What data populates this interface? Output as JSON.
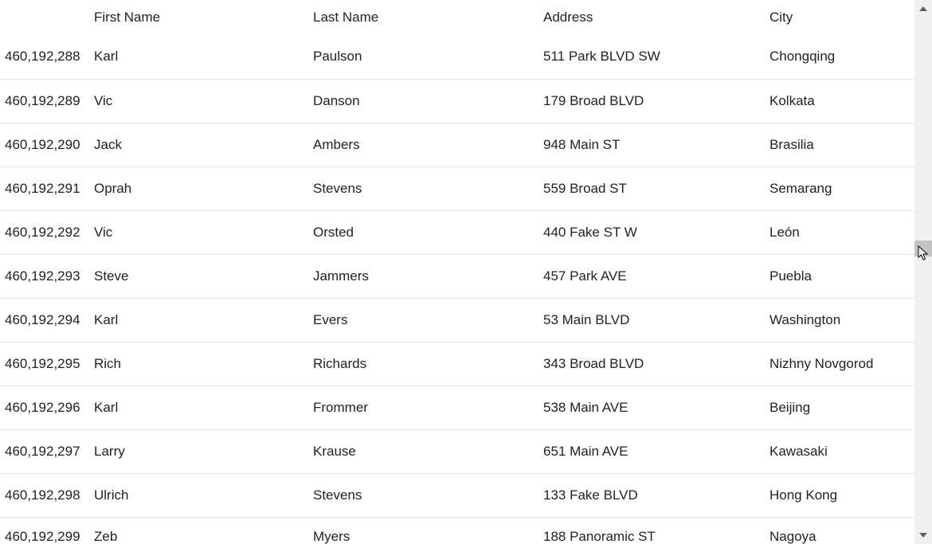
{
  "table": {
    "headers": {
      "id": "",
      "firstName": "First Name",
      "lastName": "Last Name",
      "address": "Address",
      "city": "City"
    },
    "rows": [
      {
        "id": "460,192,288",
        "firstName": "Karl",
        "lastName": "Paulson",
        "address": "511 Park BLVD SW",
        "city": "Chongqing"
      },
      {
        "id": "460,192,289",
        "firstName": "Vic",
        "lastName": "Danson",
        "address": "179 Broad BLVD",
        "city": "Kolkata"
      },
      {
        "id": "460,192,290",
        "firstName": "Jack",
        "lastName": "Ambers",
        "address": "948 Main ST",
        "city": "Brasilia"
      },
      {
        "id": "460,192,291",
        "firstName": "Oprah",
        "lastName": "Stevens",
        "address": "559 Broad ST",
        "city": "Semarang"
      },
      {
        "id": "460,192,292",
        "firstName": "Vic",
        "lastName": "Orsted",
        "address": "440 Fake ST W",
        "city": "León"
      },
      {
        "id": "460,192,293",
        "firstName": "Steve",
        "lastName": "Jammers",
        "address": "457 Park AVE",
        "city": "Puebla"
      },
      {
        "id": "460,192,294",
        "firstName": "Karl",
        "lastName": "Evers",
        "address": "53 Main BLVD",
        "city": "Washington"
      },
      {
        "id": "460,192,295",
        "firstName": "Rich",
        "lastName": "Richards",
        "address": "343 Broad BLVD",
        "city": "Nizhny Novgorod"
      },
      {
        "id": "460,192,296",
        "firstName": "Karl",
        "lastName": "Frommer",
        "address": "538 Main AVE",
        "city": "Beijing"
      },
      {
        "id": "460,192,297",
        "firstName": "Larry",
        "lastName": "Krause",
        "address": "651 Main AVE",
        "city": "Kawasaki"
      },
      {
        "id": "460,192,298",
        "firstName": "Ulrich",
        "lastName": "Stevens",
        "address": "133 Fake BLVD",
        "city": "Hong Kong"
      },
      {
        "id": "460,192,299",
        "firstName": "Zeb",
        "lastName": "Myers",
        "address": "188 Panoramic ST",
        "city": "Nagoya"
      }
    ]
  }
}
